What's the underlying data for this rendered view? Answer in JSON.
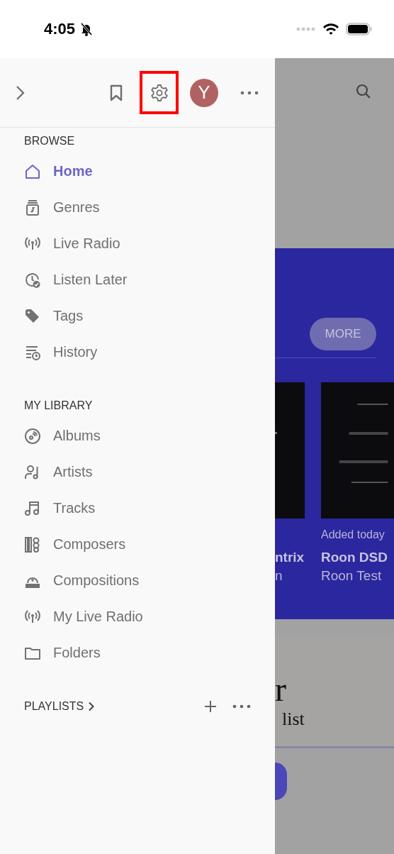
{
  "status_bar": {
    "time": "4:05",
    "silent": true
  },
  "drawer": {
    "toolbar": [
      {
        "kind": "expand",
        "highlighted": false
      },
      {
        "kind": "bookmark",
        "highlighted": false
      },
      {
        "kind": "settings",
        "highlighted": true
      },
      {
        "kind": "avatar",
        "initial": "Y",
        "color": "#b06262",
        "highlighted": false
      },
      {
        "kind": "more",
        "highlighted": false
      }
    ],
    "sections": [
      {
        "title": "BROWSE",
        "items": [
          {
            "label": "Home",
            "kind": "home",
            "selected": true
          },
          {
            "label": "Genres",
            "kind": "genres",
            "selected": false
          },
          {
            "label": "Live Radio",
            "kind": "radio",
            "selected": false
          },
          {
            "label": "Listen Later",
            "kind": "later",
            "selected": false
          },
          {
            "label": "Tags",
            "kind": "tag",
            "selected": false
          },
          {
            "label": "History",
            "kind": "history",
            "selected": false
          }
        ]
      },
      {
        "title": "MY LIBRARY",
        "items": [
          {
            "label": "Albums",
            "kind": "album",
            "selected": false
          },
          {
            "label": "Artists",
            "kind": "artist",
            "selected": false
          },
          {
            "label": "Tracks",
            "kind": "tracks",
            "selected": false
          },
          {
            "label": "Composers",
            "kind": "composers",
            "selected": false
          },
          {
            "label": "Compositions",
            "kind": "compositions",
            "selected": false
          },
          {
            "label": "My Live Radio",
            "kind": "radio",
            "selected": false
          },
          {
            "label": "Folders",
            "kind": "folder",
            "selected": false
          }
        ]
      }
    ],
    "playlists": {
      "title": "PLAYLISTS"
    }
  },
  "background": {
    "more_button": "MORE",
    "cards": [
      {
        "title": "ntrix",
        "subtitle": "n"
      },
      {
        "date": "Added today",
        "title": "Roon DSD",
        "subtitle": "Roon Test"
      }
    ],
    "heading": "r",
    "subheading": "list"
  }
}
